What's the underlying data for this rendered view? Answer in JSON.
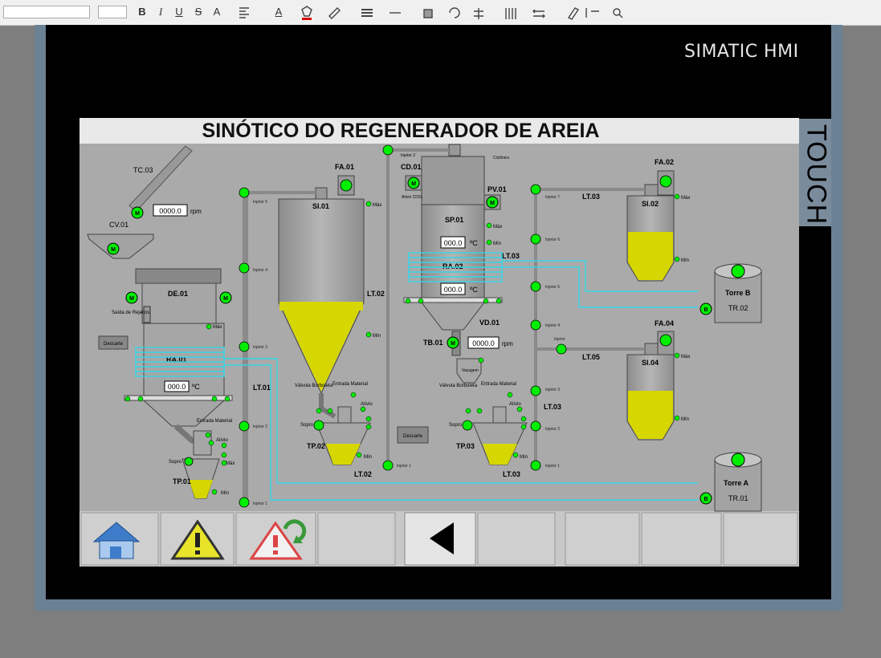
{
  "toolbar": {
    "icons": [
      "font-size-stepper",
      "bold-icon",
      "italic-icon",
      "underline-icon",
      "strikethrough-icon",
      "font-size-increase-icon",
      "align-icon",
      "font-color-icon",
      "fill-color-icon",
      "line-color-icon",
      "line-weight-icon",
      "line-style-icon",
      "arrange-icon",
      "rotate-icon",
      "align-objects-icon",
      "distribute-icon",
      "spacing-icon",
      "format-painter-icon",
      "flip-icon",
      "zoom-icon"
    ],
    "bold": "B",
    "italic": "I",
    "underline": "U",
    "strike": "S",
    "fontsize": "A",
    "fontcolor": "A"
  },
  "device": {
    "brand": "SIMATIC HMI",
    "touch_label": "TOUCH"
  },
  "screen": {
    "title": "SINÓTICO DO REGENERADOR DE AREIA",
    "tags": {
      "tc03": "TC.03",
      "cv01": "CV.01",
      "de01": "DE.01",
      "ra01": "RA.01",
      "saida_rejeitos": "Saída de Rejeitos",
      "descarte": "Descarte",
      "tp01": "TP.01",
      "si01": "SI.01",
      "fa01": "FA.01",
      "lt01": "LT.01",
      "lt02_mid": "LT.02",
      "tp02": "TP.02",
      "lt02": "LT.02",
      "cd01": "CD.01",
      "sp01": "SP.01",
      "pv01": "PV.01",
      "ra02": "RA.02",
      "vd01": "VD.01",
      "tb01": "TB.01",
      "lt03_a": "LT.03",
      "lt03_b": "LT.03",
      "tp03": "TP.03",
      "lt03_c": "LT.03",
      "si02": "SI.02",
      "fa02": "FA.02",
      "si04": "SI.04",
      "fa04": "FA.04",
      "lt05": "LT.05",
      "torre_b": "Torre B",
      "tr02": "TR.02",
      "torre_a": "Torre A",
      "tr01": "TR.01",
      "descarte2": "Descarte",
      "entrada1": "Entrada Material",
      "alivio1": "Alívio",
      "entrada2": "Entrada Material",
      "alivio2": "Alívio",
      "valvula2": "Válvula Borboleta",
      "entrada3": "Entrada Material",
      "alivio3": "Alívio",
      "valvula3": "Válvula Borboleta",
      "vazagem": "Vazagem",
      "alivio_cd": "Alívio CD01",
      "cerlico": "Ciclônico"
    },
    "injetores": {
      "i1": "Injetor 1",
      "i2": "Injetor 2",
      "i3": "Injetor 3",
      "i4": "Injetor 4",
      "i5": "Injetor 5",
      "j1": "Injetor 1",
      "j2": "Injetor 2",
      "j3": "Injetor 3",
      "j4": "Injetor 4",
      "j5": "Injetor 5",
      "j6": "Injetor 6",
      "j7": "Injetor 7",
      "jt": "Injetor",
      "k1": "Injetor 1",
      "k2": "Injetor 2"
    },
    "small": {
      "max": "Máx",
      "min": "Mín",
      "soprar": "Sopro",
      "f": "F",
      "a": "A",
      "motor": "M",
      "blower": "B"
    },
    "values": {
      "tc03_rpm": "0000.0",
      "rpm_unit": "rpm",
      "ra01_temp": "000.0",
      "ra02_temp_top": "000.0",
      "ra02_temp_bot": "000.0",
      "temp_unit": "ºC",
      "tb01_rpm": "0000.0"
    },
    "levels": {
      "si01": 0.5,
      "si02": 0.45,
      "si04": 0.55,
      "tp01": 0.45,
      "tp02": 0.5,
      "tp03": 0.5
    }
  },
  "nav": {
    "buttons": [
      "home-button",
      "alarm-button",
      "alarm-reset-button",
      "empty-button-1",
      "back-button",
      "empty-button-2",
      "empty-button-3",
      "empty-button-4",
      "empty-button-5"
    ]
  },
  "colors": {
    "indicator_on": "#00ee00",
    "material": "#d6d600",
    "pipe_air": "#33d6e8",
    "vessel": "#a8a8a8"
  }
}
